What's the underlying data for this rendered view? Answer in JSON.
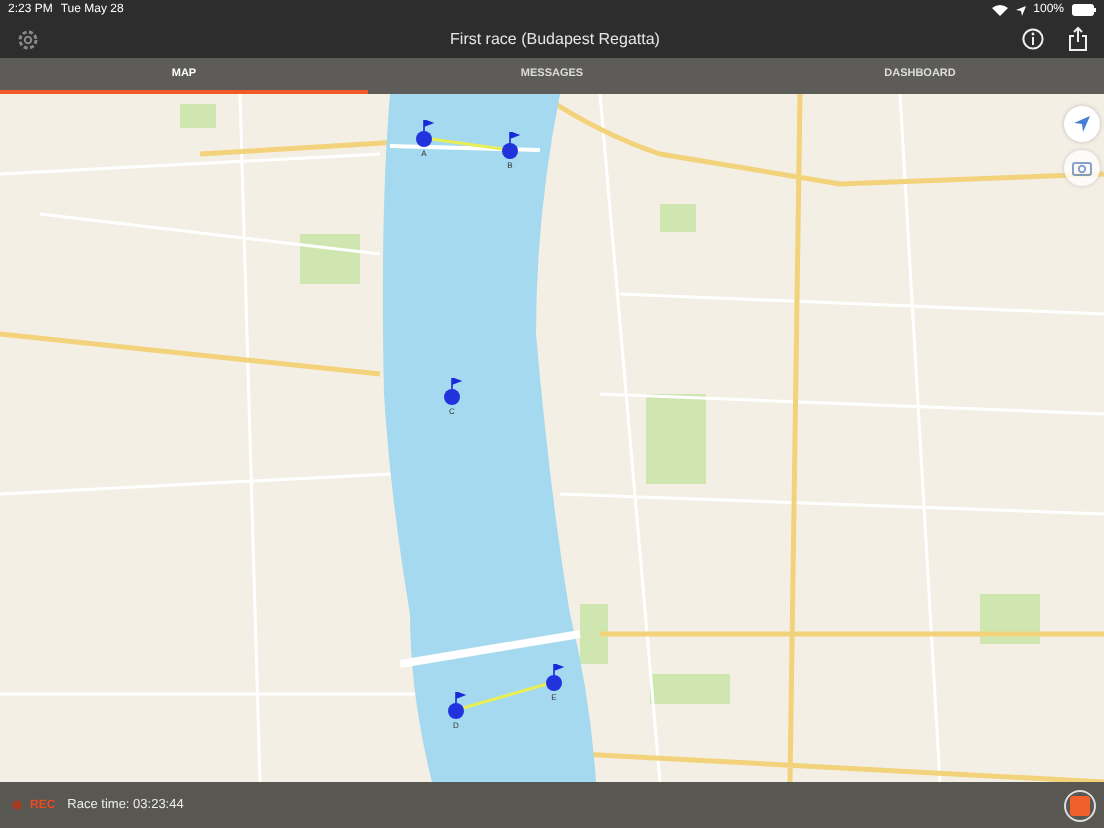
{
  "status_bar": {
    "time": "2:23 PM",
    "date": "Tue May 28",
    "battery": "100%"
  },
  "nav": {
    "title": "First race (Budapest Regatta)"
  },
  "tabs": [
    {
      "label": "MAP",
      "selected": true
    },
    {
      "label": "MESSAGES",
      "selected": false
    },
    {
      "label": "DASHBOARD",
      "selected": false
    }
  ],
  "buoys": [
    {
      "label": "A"
    },
    {
      "label": "B"
    },
    {
      "label": "C"
    },
    {
      "label": "D"
    },
    {
      "label": "E"
    }
  ],
  "recording": {
    "on": true,
    "label": "REC",
    "race_time": "Race time: 03:23:44"
  }
}
